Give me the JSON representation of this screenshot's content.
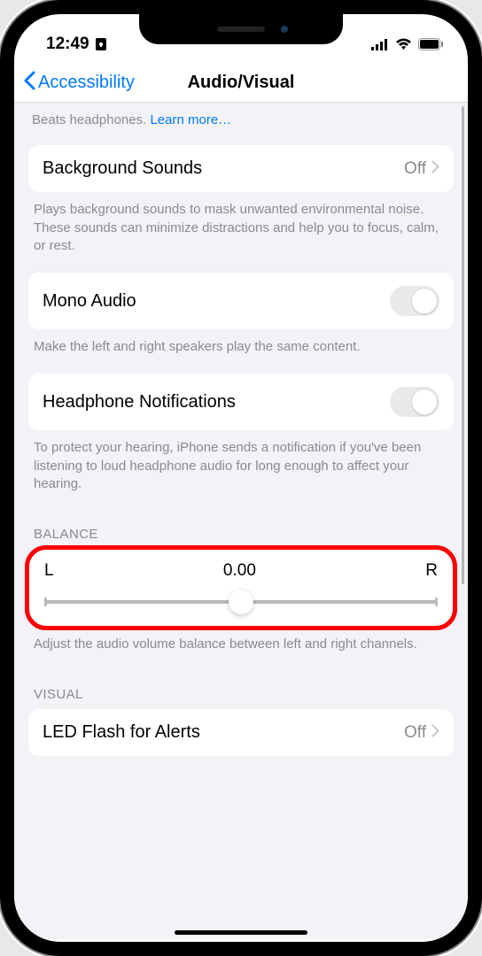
{
  "statusBar": {
    "time": "12:49"
  },
  "nav": {
    "backLabel": "Accessibility",
    "title": "Audio/Visual"
  },
  "topFragment": {
    "line": "Beats headphones. ",
    "learnMore": "Learn more…"
  },
  "backgroundSounds": {
    "label": "Background Sounds",
    "value": "Off",
    "footer": "Plays background sounds to mask unwanted environmental noise. These sounds can minimize distractions and help you to focus, calm, or rest."
  },
  "monoAudio": {
    "label": "Mono Audio",
    "footer": "Make the left and right speakers play the same content."
  },
  "headphoneNotifications": {
    "label": "Headphone Notifications",
    "footer": "To protect your hearing, iPhone sends a notification if you've been listening to loud headphone audio for long enough to affect your hearing."
  },
  "balance": {
    "header": "BALANCE",
    "left": "L",
    "value": "0.00",
    "right": "R",
    "footer": "Adjust the audio volume balance between left and right channels."
  },
  "visual": {
    "header": "VISUAL"
  },
  "ledFlash": {
    "label": "LED Flash for Alerts",
    "value": "Off"
  }
}
